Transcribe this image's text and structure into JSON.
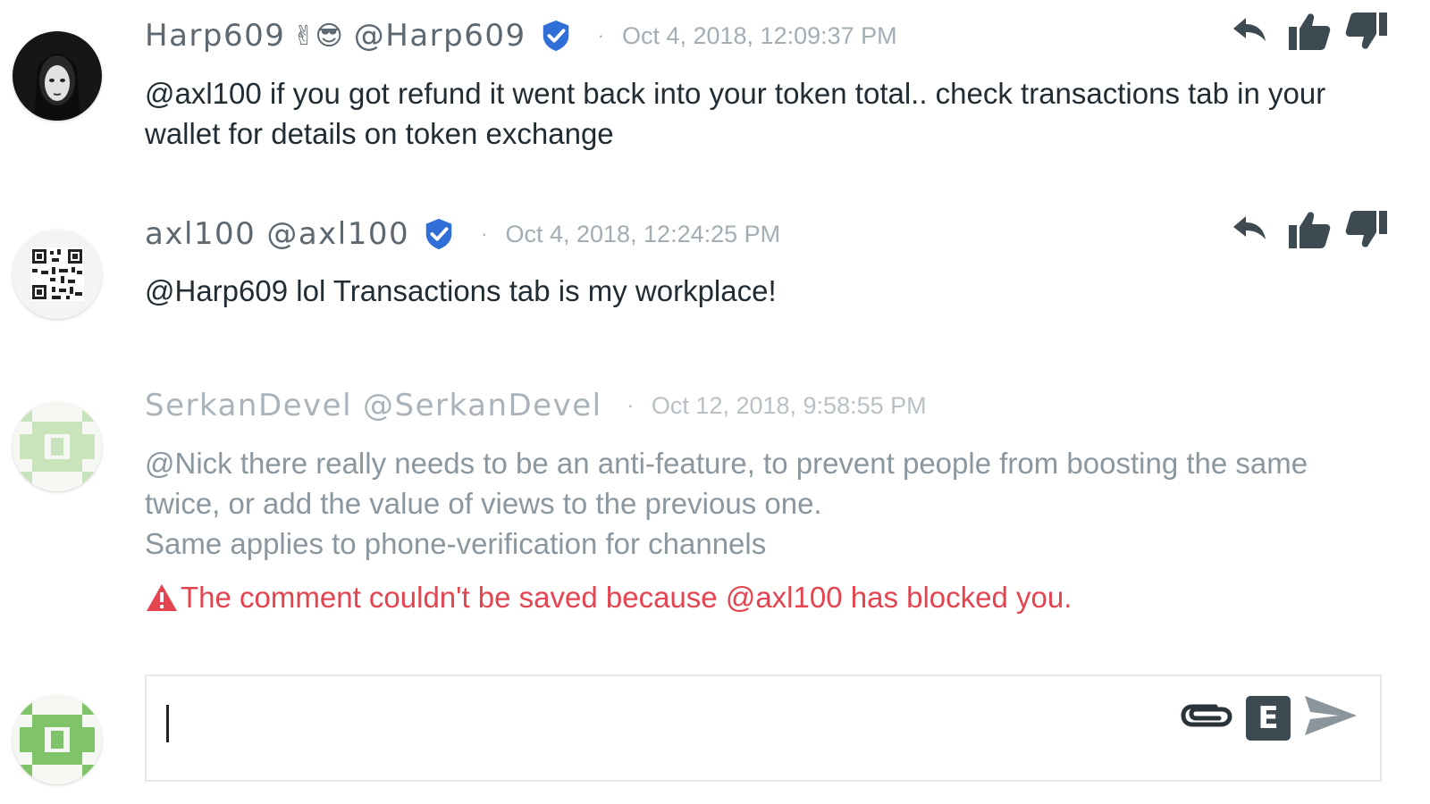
{
  "comments": [
    {
      "display_name": "Harp609",
      "emoji": "✌😎",
      "handle": "@Harp609",
      "verified": true,
      "timestamp": "Oct 4, 2018, 12:09:37 PM",
      "mention": "@axl100",
      "text": " if you got refund it went back into your token total.. check transactions tab in your wallet for details on token exchange"
    },
    {
      "display_name": "axl100",
      "handle": "@axl100",
      "verified": true,
      "timestamp": "Oct 4, 2018, 12:24:25 PM",
      "mention": "@Harp609",
      "text": " lol Transactions tab is my workplace!"
    },
    {
      "display_name": "SerkanDevel",
      "handle": "@SerkanDevel",
      "verified": false,
      "pending": true,
      "timestamp": "Oct 12, 2018, 9:58:55 PM",
      "mention": "@Nick",
      "text": " there really needs to be an anti-feature, to prevent people from boosting the same twice, or add the value of views to the previous one.",
      "text_line2": "Same applies to phone-verification for channels",
      "error": "The comment couldn't be saved because @axl100 has blocked you."
    }
  ],
  "composer": {
    "value": "",
    "emoji_button_label": "E"
  },
  "icons": {
    "reply": "reply-icon",
    "like": "thumbs-up-icon",
    "dislike": "thumbs-down-icon",
    "verified": "verified-badge-icon",
    "warning": "warning-icon",
    "attach": "paperclip-icon",
    "send": "send-icon"
  },
  "colors": {
    "text": "#222c33",
    "meta": "#a3adb4",
    "verified_blue": "#2f6fd7",
    "error_red": "#e4444f",
    "icon_dark": "#3d4a52"
  }
}
